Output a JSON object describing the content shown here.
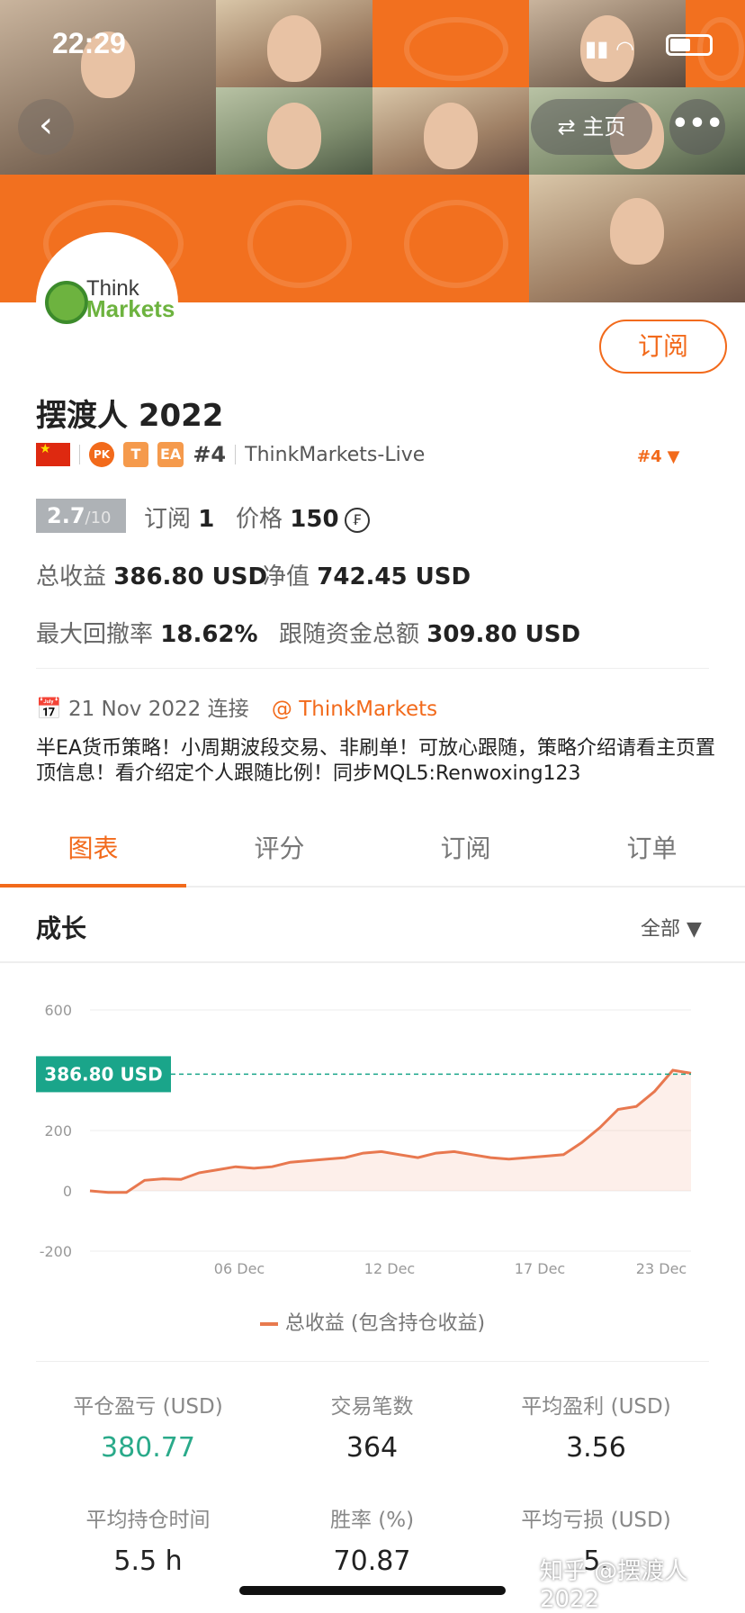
{
  "status": {
    "time": "22:29"
  },
  "nav": {
    "back": "‹",
    "home_label": "主页",
    "home_icon": "⇄",
    "more": "•••"
  },
  "broker": {
    "logo_think": "Think",
    "logo_markets": "Markets"
  },
  "profile": {
    "subscribe_label": "订阅",
    "name": "摆渡人 2022",
    "pk": "PK",
    "badge_t": "T",
    "badge_ea": "EA",
    "rank_small": "#4",
    "server": "ThinkMarkets-Live",
    "rank_big": "#4"
  },
  "summary": {
    "score": "2.7",
    "score_max": "/10",
    "subs_label": "订阅",
    "subs_value": "1",
    "price_label": "价格",
    "price_value": "150",
    "price_icon": "₣",
    "profit_label": "总收益",
    "profit_value": "386.80 USD",
    "equity_label": "净值",
    "equity_value": "742.45 USD",
    "dd_label": "最大回撤率",
    "dd_value": "18.62%",
    "follow_label": "跟随资金总额",
    "follow_value": "309.80 USD",
    "connected": "21 Nov 2022 连接",
    "broker_at": "@ ThinkMarkets",
    "description": "半EA货币策略！小周期波段交易、非刷单！可放心跟随，策略介绍请看主页置顶信息！看介绍定个人跟随比例！同步MQL5:Renwoxing123"
  },
  "tabs": [
    "图表",
    "评分",
    "订阅",
    "订单"
  ],
  "section": {
    "title": "成长",
    "filter": "全部 ▼"
  },
  "chart_data": {
    "type": "area",
    "series": [
      {
        "name": "总收益 (包含持仓收益)",
        "values": [
          0,
          -5,
          -5,
          35,
          40,
          38,
          60,
          70,
          80,
          75,
          80,
          95,
          100,
          105,
          110,
          125,
          130,
          120,
          110,
          125,
          130,
          120,
          110,
          105,
          110,
          115,
          120,
          160,
          210,
          270,
          280,
          330,
          400,
          390
        ]
      }
    ],
    "x_ticks": [
      "06 Dec",
      "12 Dec",
      "17 Dec",
      "23 Dec"
    ],
    "y_ticks": [
      "600",
      "200",
      "0",
      "-200"
    ],
    "ylim": [
      -200,
      600
    ],
    "current_label": "386.80 USD",
    "current_value": 386.8,
    "legend": "总收益 (包含持仓收益)"
  },
  "stats": [
    {
      "label": "平仓盈亏 (USD)",
      "value": "380.77"
    },
    {
      "label": "交易笔数",
      "value": "364"
    },
    {
      "label": "平均盈利 (USD)",
      "value": "3.56"
    },
    {
      "label": "平均持仓时间",
      "value": "5.5 h"
    },
    {
      "label": "胜率 (%)",
      "value": "70.87"
    },
    {
      "label": "平均亏损 (USD)",
      "value": "5."
    }
  ],
  "watermark": "知乎 @摆渡人2022"
}
